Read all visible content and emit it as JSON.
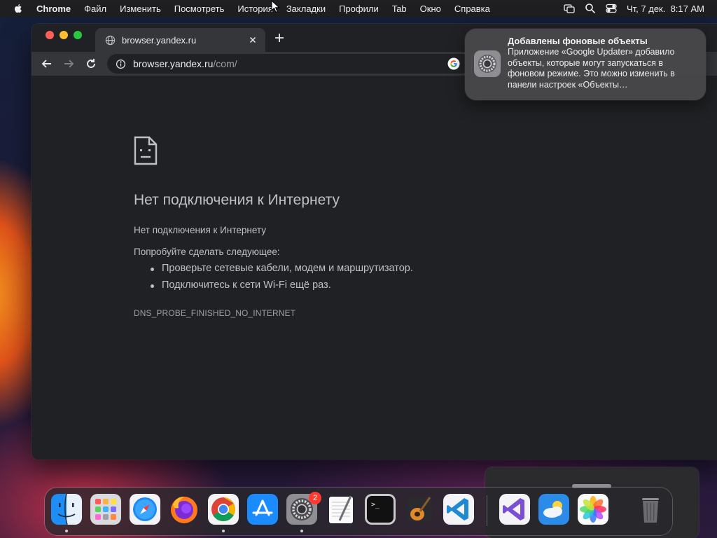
{
  "menubar": {
    "app_name": "Chrome",
    "menus": [
      "Файл",
      "Изменить",
      "Посмотреть",
      "История",
      "Закладки",
      "Профили",
      "Tab",
      "Окно",
      "Справка"
    ],
    "clock": "Чт, 7 дек.  8:17 AM"
  },
  "browser": {
    "tab_title": "browser.yandex.ru",
    "url_host": "browser.yandex.ru",
    "url_path": "/com/"
  },
  "error_page": {
    "title": "Нет подключения к Интернету",
    "subtitle": "Нет подключения к Интернету",
    "suggestion_heading": "Попробуйте сделать следующее:",
    "suggestions": [
      "Проверьте сетевые кабели, модем и маршрутизатор.",
      "Подключитесь к сети Wi-Fi ещё раз."
    ],
    "error_code": "DNS_PROBE_FINISHED_NO_INTERNET"
  },
  "notification": {
    "title": "Добавлены фоновые объекты",
    "body": "Приложение «Google Updater» добавило объекты, которые могут запускаться в фоновом режиме. Это можно изменить в панели настроек «Объекты…"
  },
  "dock": {
    "items": [
      {
        "name": "finder-icon",
        "running": true
      },
      {
        "name": "launchpad-icon",
        "running": false
      },
      {
        "name": "safari-icon",
        "running": false
      },
      {
        "name": "firefox-icon",
        "running": false
      },
      {
        "name": "chrome-icon",
        "running": true
      },
      {
        "name": "app-store-icon",
        "running": false
      },
      {
        "name": "system-settings-icon",
        "running": true,
        "badge": "2"
      },
      {
        "name": "textedit-icon",
        "running": false
      },
      {
        "name": "terminal-icon",
        "running": false
      },
      {
        "name": "garageband-icon",
        "running": false
      },
      {
        "name": "vscode-icon",
        "running": false
      },
      {
        "name": "visual-studio-icon",
        "running": false
      },
      {
        "name": "weather-icon",
        "running": false
      },
      {
        "name": "photos-icon",
        "running": false
      },
      {
        "name": "trash-icon",
        "running": false
      }
    ]
  },
  "colors": {
    "window_bg": "#202124",
    "toolbar_bg": "#35363a",
    "close": "#fe5f57",
    "minimize": "#febc2e",
    "maximize": "#28c840",
    "badge": "#ff3b30"
  }
}
